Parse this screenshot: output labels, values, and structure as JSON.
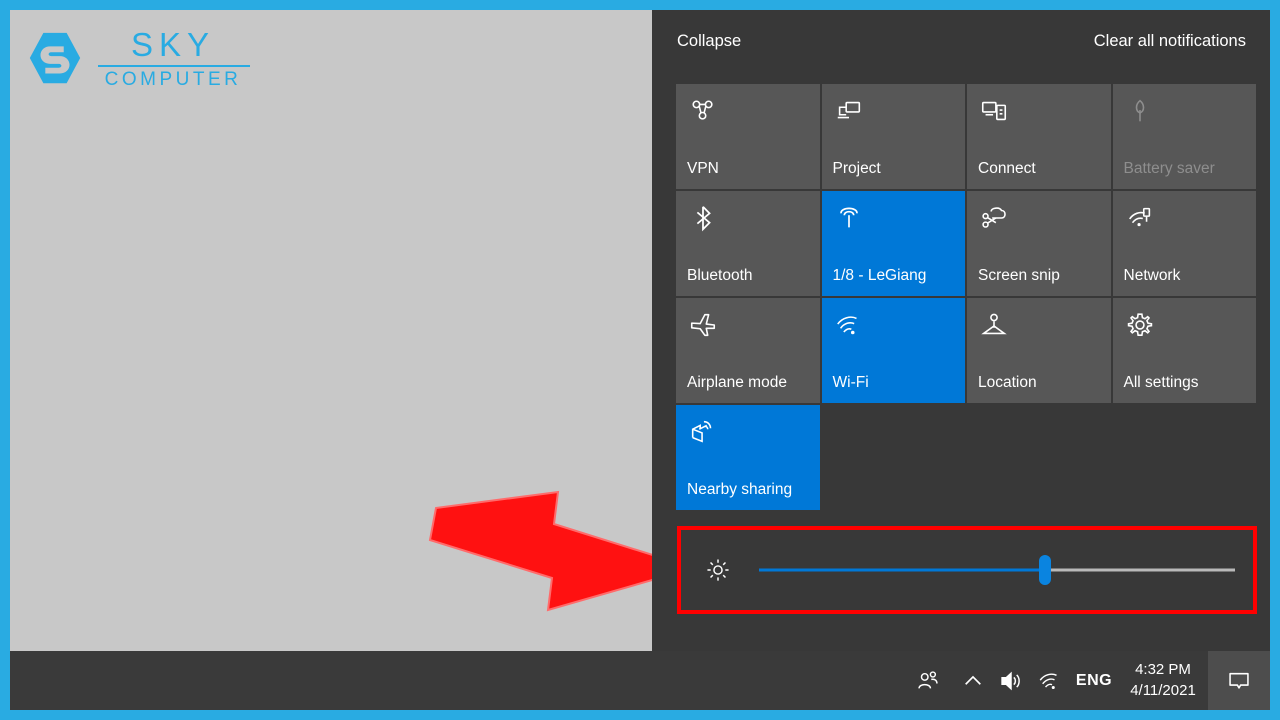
{
  "theme": {
    "border_color": "#29ABE2",
    "desktop_bg": "#c8c8c8",
    "panel_bg": "#383838",
    "tile_bg": "#575757",
    "tile_on_bg": "#0078d7",
    "taskbar_bg": "#3a3a3a",
    "highlight_color": "#ff0000",
    "accent_blue": "#0078d7"
  },
  "logo": {
    "mark": "hexagon-s-logo",
    "title": "SKY",
    "subtitle": "COMPUTER"
  },
  "annotation": {
    "arrow": "red-arrow-pointing-right",
    "highlight_target": "brightness-slider"
  },
  "action_center": {
    "collapse_label": "Collapse",
    "clear_all_label": "Clear all notifications",
    "tiles": [
      [
        {
          "label": "VPN",
          "icon": "vpn-icon",
          "state": "off"
        },
        {
          "label": "Project",
          "icon": "project-icon",
          "state": "off"
        },
        {
          "label": "Connect",
          "icon": "connect-icon",
          "state": "off"
        },
        {
          "label": "Battery saver",
          "icon": "battery-saver-leaf-icon",
          "state": "disabled"
        }
      ],
      [
        {
          "label": "Bluetooth",
          "icon": "bluetooth-icon",
          "state": "off"
        },
        {
          "label": "1/8 - LeGiang",
          "icon": "mobile-hotspot-icon",
          "state": "on"
        },
        {
          "label": "Screen snip",
          "icon": "screen-snip-icon",
          "state": "off"
        },
        {
          "label": "Network",
          "icon": "network-icon",
          "state": "off"
        }
      ],
      [
        {
          "label": "Airplane mode",
          "icon": "airplane-icon",
          "state": "off"
        },
        {
          "label": "Wi-Fi",
          "icon": "wifi-icon",
          "state": "on"
        },
        {
          "label": "Location",
          "icon": "location-icon",
          "state": "off"
        },
        {
          "label": "All settings",
          "icon": "gear-icon",
          "state": "off"
        }
      ],
      [
        {
          "label": "Nearby sharing",
          "icon": "nearby-sharing-icon",
          "state": "on"
        },
        {
          "label": "",
          "icon": "",
          "state": "empty"
        },
        {
          "label": "",
          "icon": "",
          "state": "empty"
        },
        {
          "label": "",
          "icon": "",
          "state": "empty"
        }
      ]
    ],
    "brightness": {
      "icon": "brightness-sun-icon",
      "value_percent": 60,
      "min": 0,
      "max": 100
    }
  },
  "taskbar": {
    "people_icon": "people-icon",
    "chevron_icon": "chevron-up-icon",
    "volume_icon": "speaker-icon",
    "wifi_icon": "wifi-icon",
    "language": "ENG",
    "time": "4:32 PM",
    "date": "4/11/2021",
    "action_center_icon": "action-center-icon"
  }
}
